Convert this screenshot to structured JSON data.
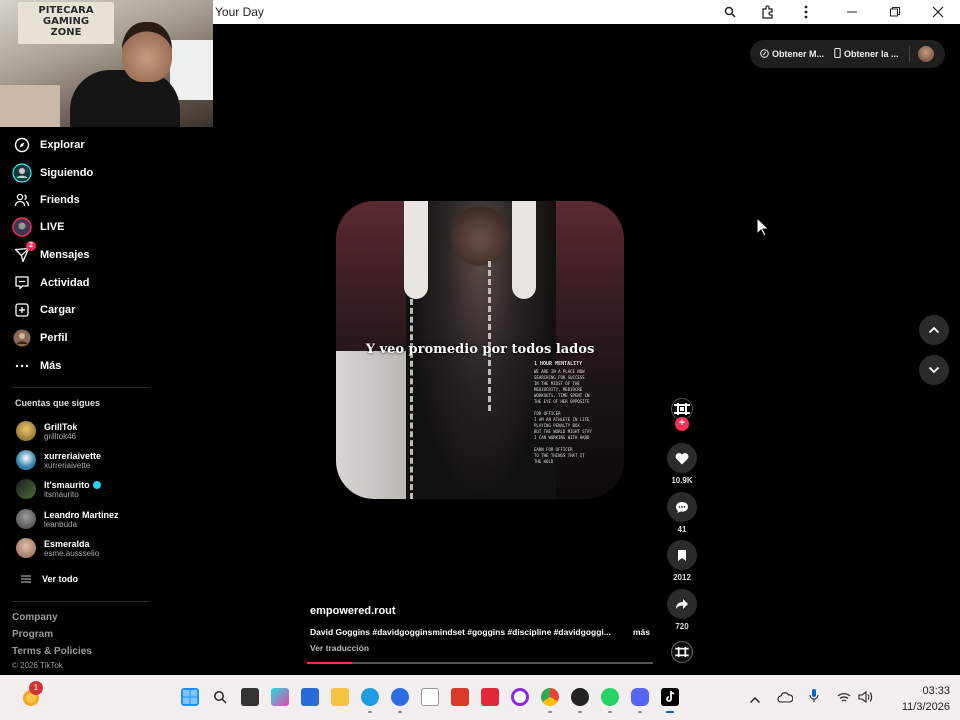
{
  "window": {
    "title": "Your Day"
  },
  "webcam_sign": "PITECARA\nGAMING\nZONE",
  "sidebar": {
    "items": [
      {
        "label": "Explorar",
        "icon": "compass-icon"
      },
      {
        "label": "Siguiendo",
        "icon": "following-icon"
      },
      {
        "label": "Friends",
        "icon": "friends-icon"
      },
      {
        "label": "LIVE",
        "icon": "live-icon"
      },
      {
        "label": "Mensajes",
        "icon": "messages-icon",
        "badge": "2"
      },
      {
        "label": "Actividad",
        "icon": "activity-icon"
      },
      {
        "label": "Cargar",
        "icon": "upload-icon"
      },
      {
        "label": "Perfil",
        "icon": "profile-icon"
      },
      {
        "label": "Más",
        "icon": "more-icon"
      }
    ],
    "following_title": "Cuentas que sigues",
    "accounts": [
      {
        "name": "GrillTok",
        "username": "grilltok46",
        "color": "#c9a35a"
      },
      {
        "name": "xurreriaivette",
        "username": "xurreriaivette",
        "color": "#2f7fa8"
      },
      {
        "name": "It'smaurito",
        "username": "itsmaurito",
        "color": "#3c3c3c",
        "verified": true
      },
      {
        "name": "Leandro Martinez",
        "username": "leanbuda",
        "color": "#6a6a6a"
      },
      {
        "name": "Esmeralda",
        "username": "esme.aussselio",
        "color": "#b38b7a"
      }
    ],
    "see_all": "Ver todo",
    "footer": {
      "company": "Company",
      "program": "Program",
      "terms": "Terms & Policies",
      "copyright": "© 2026 TikTok"
    }
  },
  "top_pill": {
    "item1": "Obtener M...",
    "item2": "Obtener la ..."
  },
  "video": {
    "caption": "Y veo promedio por todos lados",
    "poster_title": "1 HOUR MENTALITY",
    "poster_lines": [
      "WE ARE IN A PLACE NOW",
      "SEARCHING FOR SUCCESS",
      "IN THE MIDST OF THE",
      "MEDIOCRITY, MEDIOCRE",
      "WORKOUTS, TIME SPENT IN",
      "THE EYE OF HER OPPOSITE",
      "",
      "FOR OFFICER",
      "I AM AN ATHLETE IN LIFE",
      "PLAYING PENALTY BOX",
      "BUT THE WORLD MIGHT STAY",
      "I CAN WORKING WITH HARD",
      "",
      "EARN FOR OFFICER",
      "TO THE THINGS THAT IT",
      "THE HOLD"
    ],
    "author": "empowered.rout",
    "description": "David Goggins #davidgogginsmindset #goggins #discipline #davidgoggi...",
    "more": "más",
    "translate": "Ver traducción",
    "progress": 0.13
  },
  "actions": {
    "likes": "10.9K",
    "comments": "41",
    "saves": "2012",
    "shares": "720"
  },
  "taskbar": {
    "notif_badge": "1",
    "time": "03:33",
    "date": "11/3/2026"
  }
}
